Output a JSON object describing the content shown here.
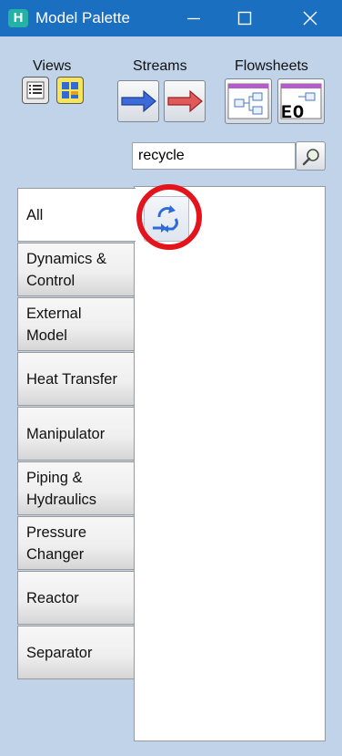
{
  "window": {
    "title": "Model Palette",
    "app_icon_letter": "H",
    "controls": [
      "minimize",
      "maximize",
      "close"
    ]
  },
  "toolbar": {
    "views_label": "Views",
    "streams_label": "Streams",
    "flowsheets_label": "Flowsheets",
    "views": [
      {
        "name": "list-view",
        "icon": "list-icon"
      },
      {
        "name": "icon-view",
        "icon": "grid-icon",
        "selected": true
      }
    ],
    "streams": [
      {
        "name": "material-stream",
        "icon": "blue-arrow-icon",
        "color": "#2c58c9"
      },
      {
        "name": "energy-stream",
        "icon": "red-arrow-icon",
        "color": "#d83a3a"
      }
    ],
    "flowsheets": [
      {
        "name": "sub-flowsheet",
        "icon": "flowsheet-icon"
      },
      {
        "name": "eo-sub-flowsheet",
        "icon": "flowsheet-eo-icon",
        "badge": "EO"
      }
    ]
  },
  "search": {
    "value": "recycle",
    "button_icon": "magnifier-icon"
  },
  "categories": [
    {
      "label": "All",
      "active": true
    },
    {
      "label": "Dynamics & Control"
    },
    {
      "label": "External Model"
    },
    {
      "label": "Heat Transfer"
    },
    {
      "label": "Manipulator"
    },
    {
      "label": "Piping & Hydraulics"
    },
    {
      "label": "Pressure Changer"
    },
    {
      "label": "Reactor"
    },
    {
      "label": "Separator"
    }
  ],
  "results": [
    {
      "name": "recycle",
      "icon": "recycle-icon",
      "highlighted": true
    }
  ],
  "colors": {
    "titlebar": "#1a6fc0",
    "background": "#c0d3e9",
    "highlight": "#e3141c"
  }
}
